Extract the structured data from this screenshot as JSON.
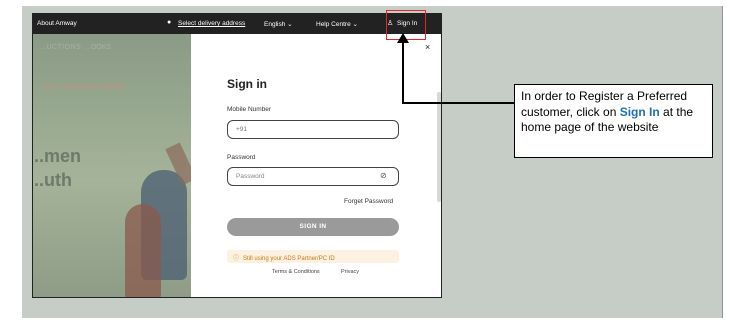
{
  "topbar": {
    "about": "About Amway",
    "delivery": "Select delivery address",
    "language": "English",
    "help": "Help Centre",
    "signin": "Sign In"
  },
  "background": {
    "nav_1": "...UCTIONS",
    "nav_2": "...OOKS",
    "notice": "...ffers to see product availability",
    "hero_line_1": "...men",
    "hero_line_2": "...uth"
  },
  "modal": {
    "close": "×",
    "title": "Sign in",
    "mobile_label": "Mobile Number",
    "mobile_value": "+91",
    "password_label": "Password",
    "password_placeholder": "Password",
    "forgot": "Forget Password",
    "signin_button": "SIGN IN",
    "notice": "Still using your ADS Partner/PC ID",
    "terms": "Terms & Conditions",
    "privacy": "Privacy"
  },
  "callout": {
    "text_before": "In order to Register a Preferred customer, click on ",
    "highlight": "Sign In",
    "text_after": " at the home page of the website"
  },
  "colors": {
    "highlight_border": "#e3262a",
    "callout_link": "#1f6fb8",
    "topbar": "#222222",
    "button": "#9a9a9a",
    "notice_text": "#c57a17"
  }
}
